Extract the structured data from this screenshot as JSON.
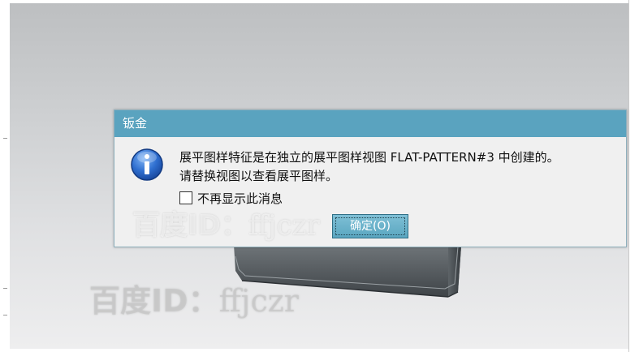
{
  "dialog": {
    "title": "钣金",
    "message_line1": "展平图样特征是在独立的展平图样视图 FLAT-PATTERN#3 中创建的。",
    "message_line2": "请替换视图以查看展平图样。",
    "checkbox_label": "不再显示此消息",
    "checkbox_checked": false,
    "ok_label": "确定(O)",
    "icon": "info-icon"
  },
  "watermark": {
    "text_bold": "百度ID：",
    "text_id": "ffjczr"
  },
  "colors": {
    "titlebar": "#5aa3bf",
    "dialog_bg": "#f0f0f0",
    "button": "#6db4cc"
  }
}
